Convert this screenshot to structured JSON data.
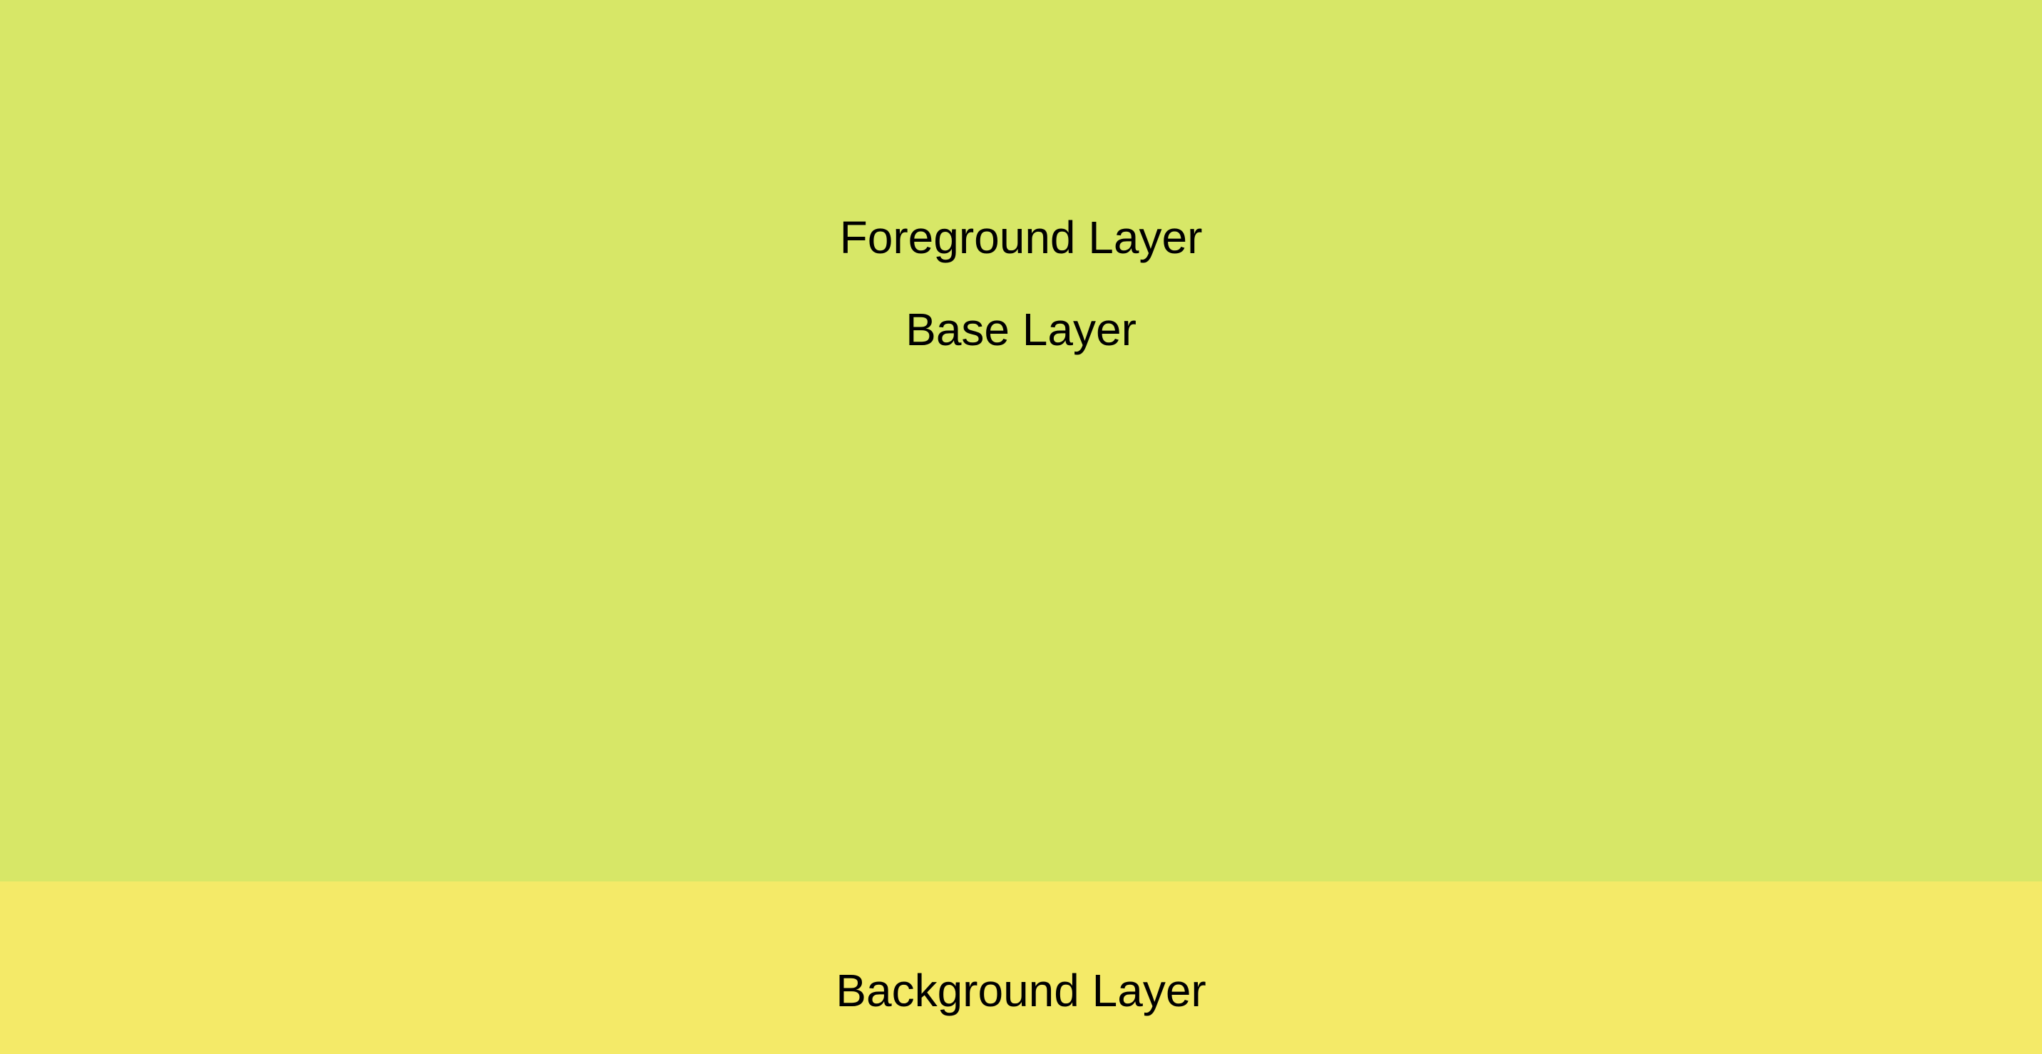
{
  "layers": {
    "foreground": {
      "label": "Foreground Layer"
    },
    "base": {
      "label": "Base Layer",
      "color": "#d7e767"
    },
    "background": {
      "label": "Background Layer",
      "color": "#f4ea68"
    }
  }
}
